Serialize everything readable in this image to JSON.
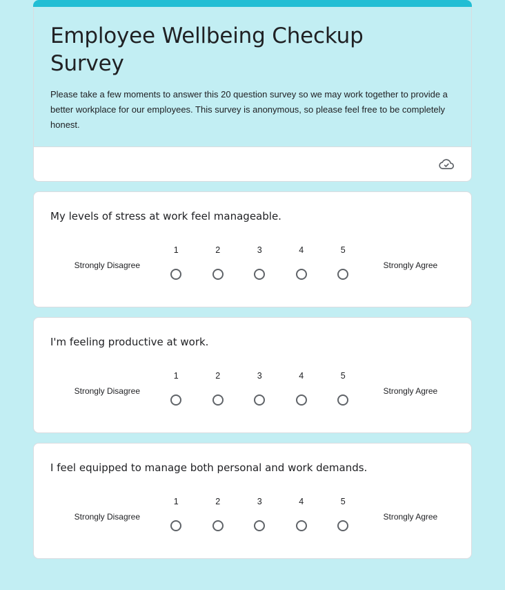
{
  "theme": {
    "page_background": "#c2eef3",
    "accent": "#22bed4",
    "card_background": "#ffffff",
    "text_primary": "#202124",
    "icon_color": "#5f6368",
    "border": "#dadce0"
  },
  "header": {
    "title": "Employee Wellbeing Checkup Survey",
    "description": "Please take a few moments to answer this 20 question survey so we may work together to provide a better workplace for our employees. This survey is anonymous, so please feel free to be completely honest.",
    "footer": {
      "save_status_icon": "cloud-done-icon"
    }
  },
  "scale": {
    "numbers": [
      "1",
      "2",
      "3",
      "4",
      "5"
    ],
    "low_label": "Strongly Disagree",
    "high_label": "Strongly Agree"
  },
  "questions": [
    {
      "title": "My levels of stress at work feel manageable."
    },
    {
      "title": "I'm feeling productive at work."
    },
    {
      "title": "I feel equipped to manage both personal and work demands."
    }
  ]
}
